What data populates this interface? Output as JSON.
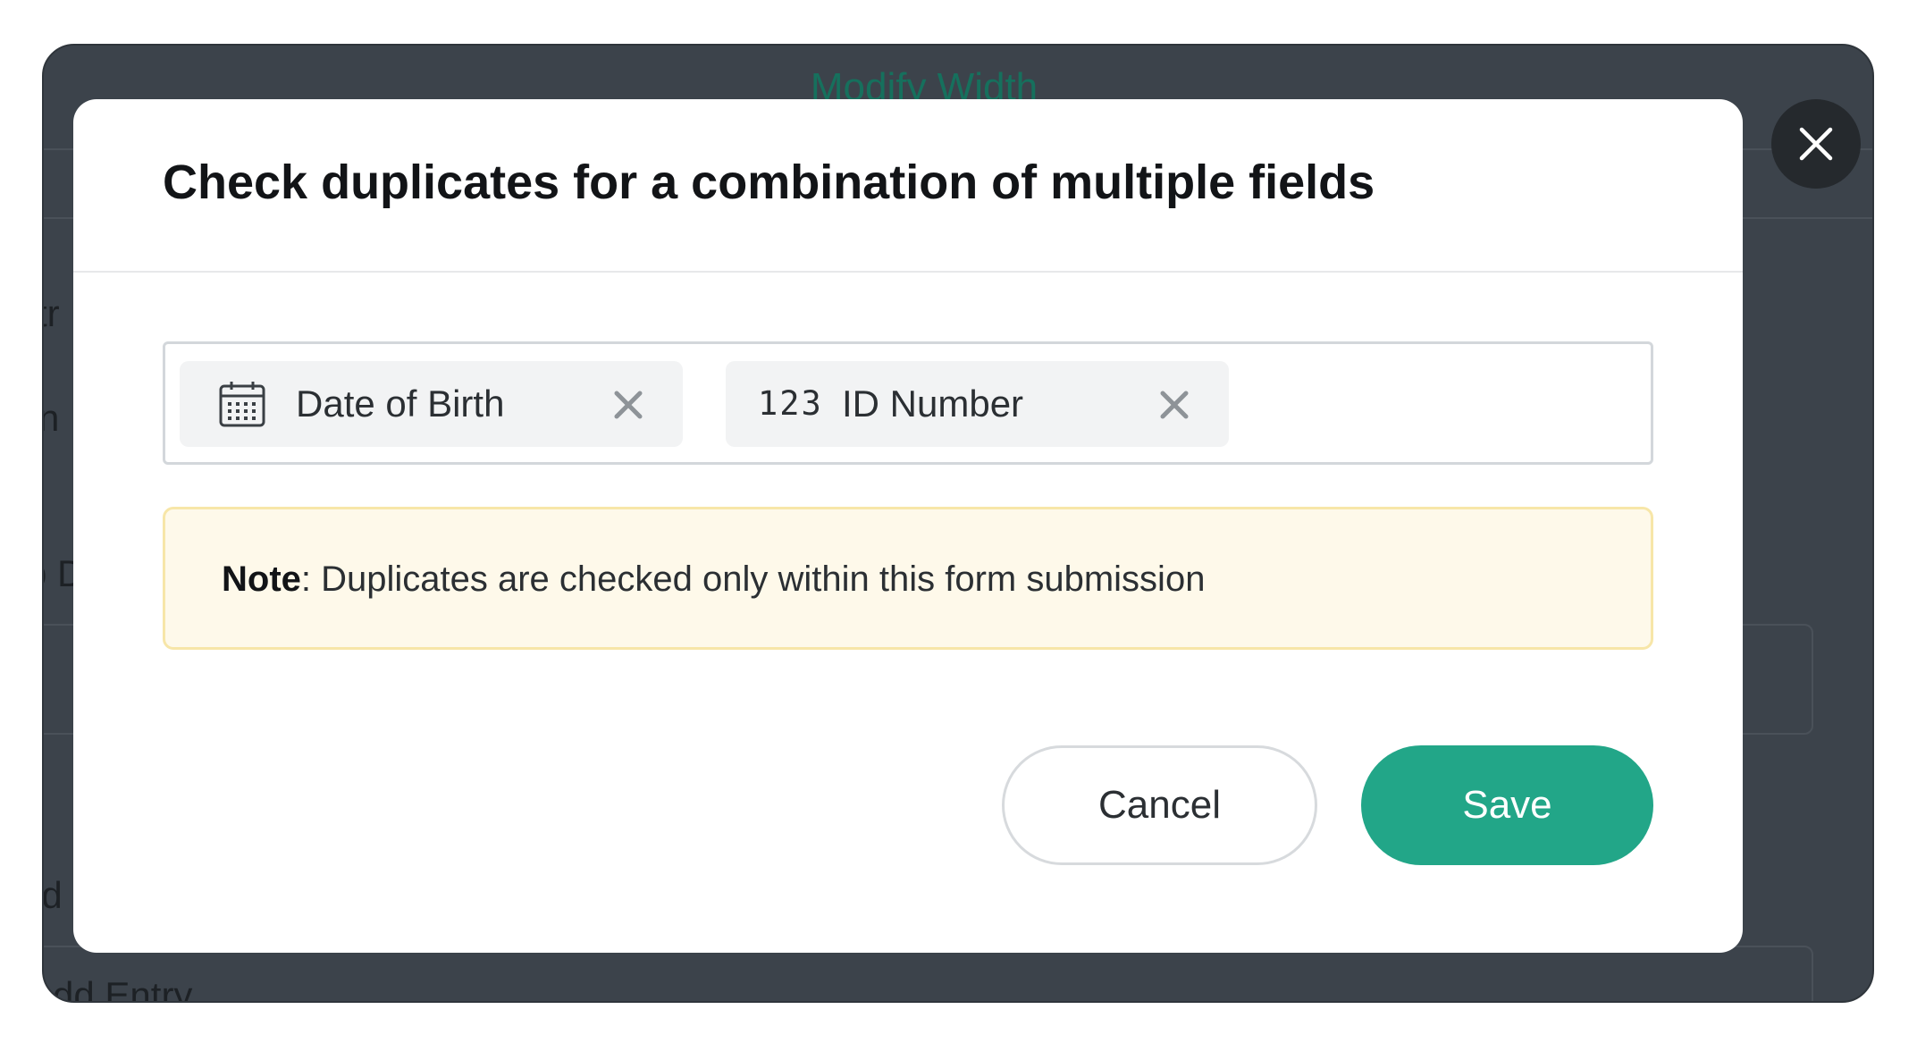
{
  "background": {
    "title": "Modify Width",
    "side_text_1": "tr",
    "side_text_2": "n",
    "side_text_3": "b D",
    "side_text_4": "ld",
    "add_entry": "Add Entry"
  },
  "modal": {
    "title": "Check duplicates for a combination of multiple fields",
    "fields": [
      {
        "label": "Date of Birth",
        "icon": "calendar-icon"
      },
      {
        "label": "ID Number",
        "icon": "number-123-icon",
        "icon_text": "123"
      }
    ],
    "note": {
      "label": "Note",
      "text": ": Duplicates are checked only within this form submission"
    },
    "buttons": {
      "cancel": "Cancel",
      "save": "Save"
    }
  },
  "colors": {
    "accent": "#22a688",
    "note_bg": "#fef9ea",
    "note_border": "#f7e6a8",
    "overlay": "#3c434b"
  }
}
